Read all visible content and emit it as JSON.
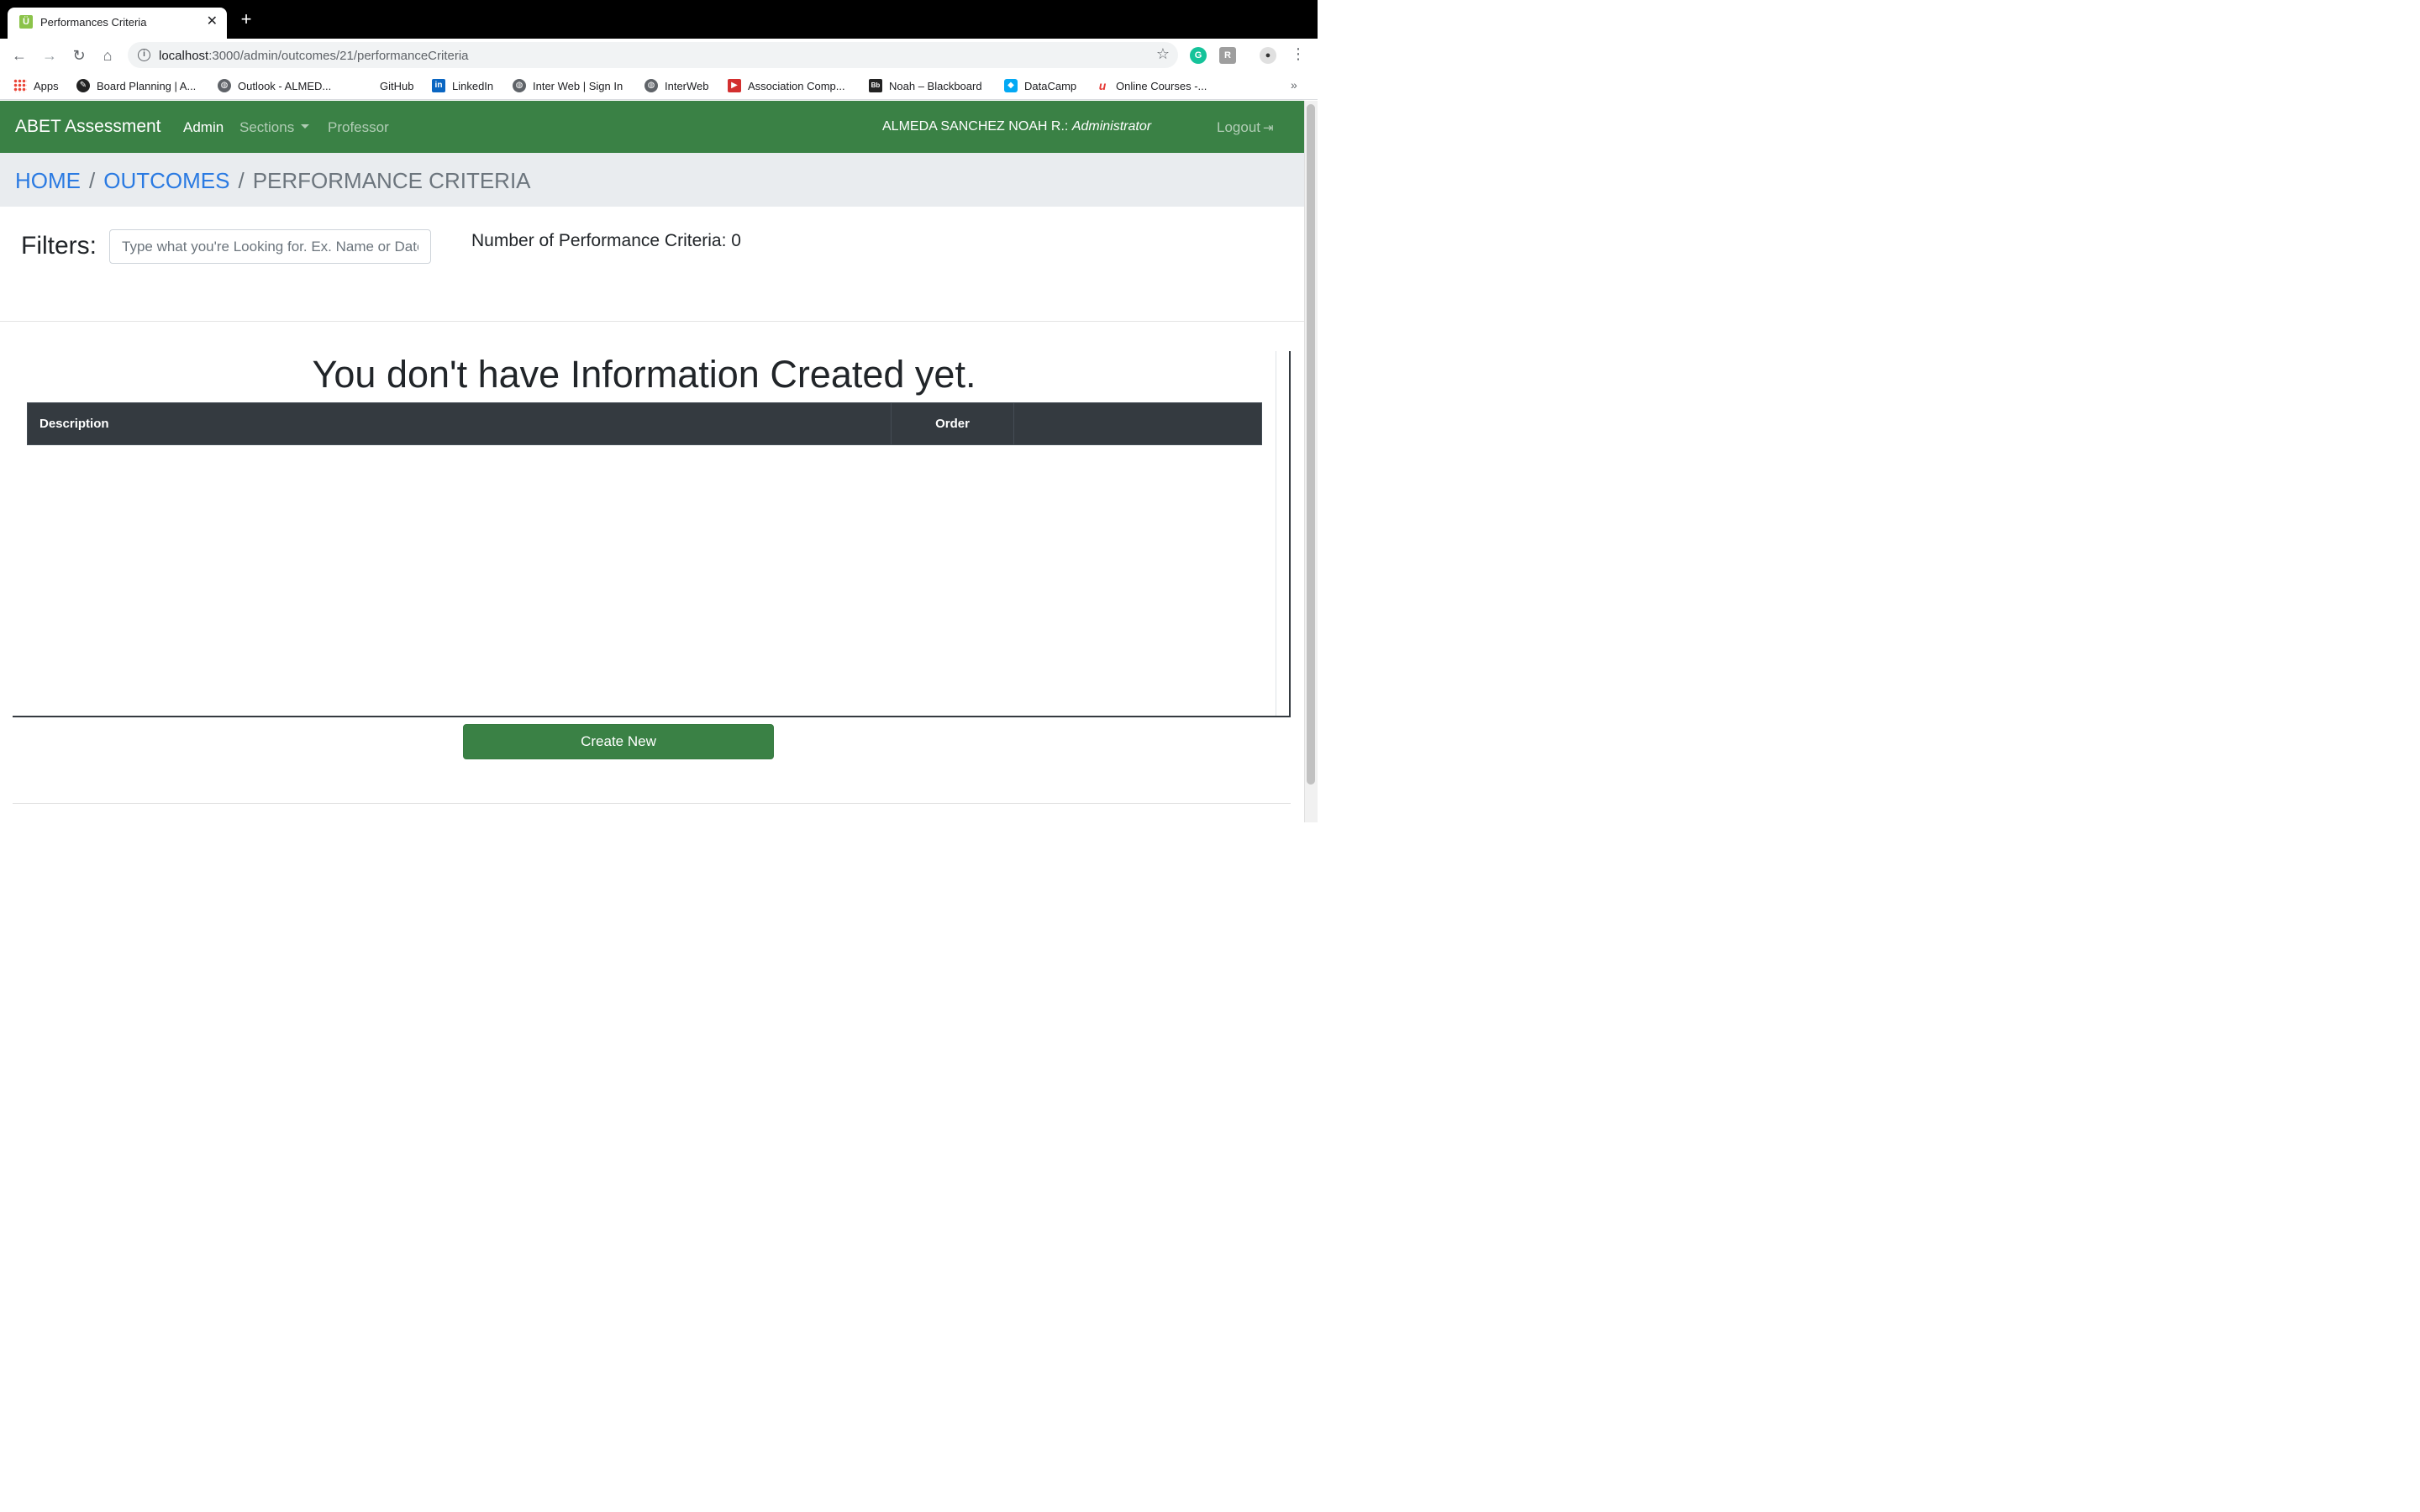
{
  "browser": {
    "tab_title": "Performances Criteria",
    "tab_close": "✕",
    "new_tab": "+",
    "url_host": "localhost",
    "url_path": ":3000/admin/outcomes/21/performanceCriteria",
    "bookmarks": [
      {
        "label": "Apps",
        "icon": "apps-grid-icon",
        "color": "#4285f4"
      },
      {
        "label": "Board Planning | A...",
        "icon": "board-planning-icon",
        "color": "#222222"
      },
      {
        "label": "Outlook - ALMED...",
        "icon": "globe-icon",
        "color": "#5f6368"
      },
      {
        "label": "GitHub",
        "icon": "github-icon",
        "color": "#ffffff"
      },
      {
        "label": "LinkedIn",
        "icon": "linkedin-icon",
        "color": "#0a66c2"
      },
      {
        "label": "Inter Web | Sign In",
        "icon": "globe-icon",
        "color": "#5f6368"
      },
      {
        "label": "InterWeb",
        "icon": "globe-icon",
        "color": "#5f6368"
      },
      {
        "label": "Association Comp...",
        "icon": "association-icon",
        "color": "#d32f2f"
      },
      {
        "label": "Noah – Blackboard",
        "icon": "blackboard-icon",
        "color": "#222222"
      },
      {
        "label": "DataCamp",
        "icon": "datacamp-icon",
        "color": "#03a9f4"
      },
      {
        "label": "Online Courses -...",
        "icon": "udemy-icon",
        "color": "#e53935"
      }
    ],
    "bookmarks_more": "»"
  },
  "navbar": {
    "brand": "ABET Assessment",
    "links": [
      {
        "label": "Admin",
        "active": true
      },
      {
        "label": "Sections",
        "active": false,
        "dropdown": true
      },
      {
        "label": "Professor",
        "active": false
      }
    ],
    "user_name": "ALMEDA SANCHEZ NOAH R.:",
    "user_role": "Administrator",
    "logout": "Logout",
    "bar_color": "#3a8145"
  },
  "breadcrumb": {
    "home": "HOME",
    "outcomes": "OUTCOMES",
    "current": "PERFORMANCE CRITERIA",
    "separator": "/"
  },
  "filters": {
    "label": "Filters:",
    "placeholder": "Type what you're Looking for. Ex. Name or Date",
    "value": "",
    "count_label": "Number of Performance Criteria: 0"
  },
  "content": {
    "empty_message": "You don't have Information Created yet.",
    "columns": [
      "Description",
      "Order",
      ""
    ],
    "rows": [],
    "create_button": "Create New",
    "button_color": "#3a8145"
  }
}
